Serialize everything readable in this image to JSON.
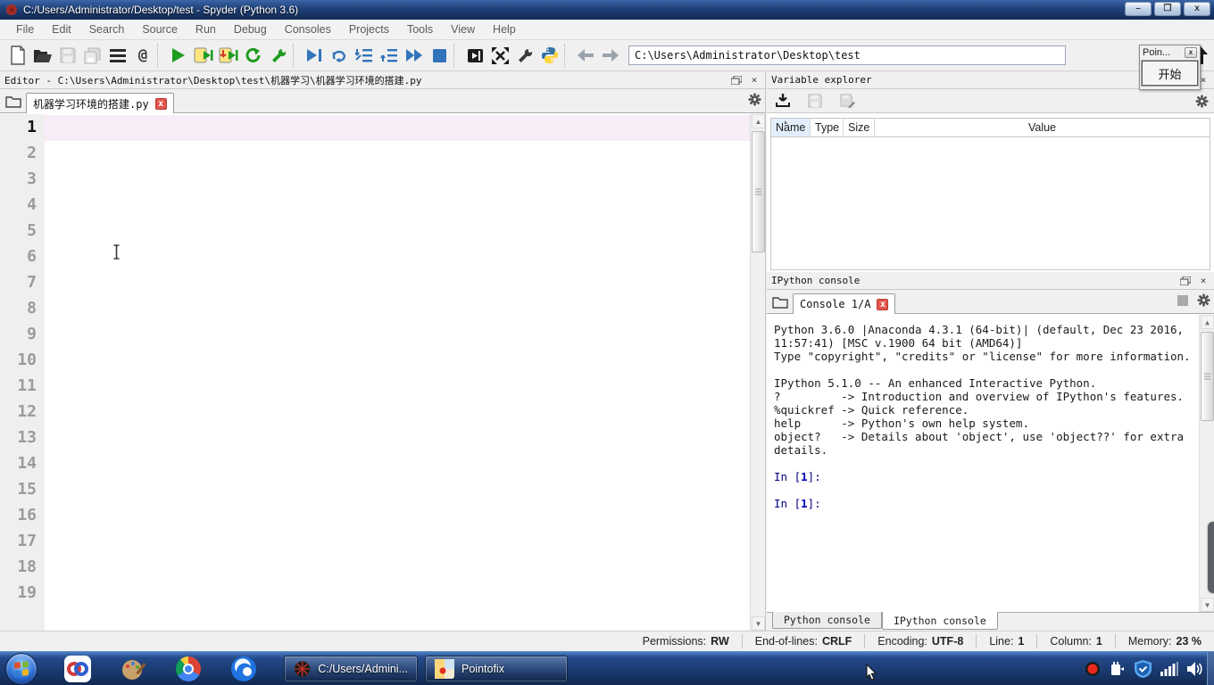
{
  "window": {
    "title": "C:/Users/Administrator/Desktop/test - Spyder (Python 3.6)",
    "buttons": {
      "minimize": "–",
      "restore": "❐",
      "close": "x"
    }
  },
  "menu": {
    "items": [
      "File",
      "Edit",
      "Search",
      "Source",
      "Run",
      "Debug",
      "Consoles",
      "Projects",
      "Tools",
      "View",
      "Help"
    ]
  },
  "toolbar": {
    "path_value": "C:\\Users\\Administrator\\Desktop\\test",
    "symbol_finder_label": "@"
  },
  "editor": {
    "header": "Editor - C:\\Users\\Administrator\\Desktop\\test\\机器学习\\机器学习环境的搭建.py",
    "tab": "机器学习环境的搭建.py",
    "tab_close": "x",
    "line_numbers": [
      "1",
      "2",
      "3",
      "4",
      "5",
      "6",
      "7",
      "8",
      "9",
      "10",
      "11",
      "12",
      "13",
      "14",
      "15",
      "16",
      "17",
      "18",
      "19"
    ]
  },
  "variable_explorer": {
    "header": "Variable explorer",
    "columns": {
      "name": "Name",
      "type": "Type",
      "size": "Size",
      "value": "Value"
    }
  },
  "console": {
    "header": "IPython console",
    "tab": "Console 1/A",
    "tab_close": "x",
    "banner": "Python 3.6.0 |Anaconda 4.3.1 (64-bit)| (default, Dec 23 2016,\n11:57:41) [MSC v.1900 64 bit (AMD64)]\nType \"copyright\", \"credits\" or \"license\" for more information.\n\nIPython 5.1.0 -- An enhanced Interactive Python.\n?         -> Introduction and overview of IPython's features.\n%quickref -> Quick reference.\nhelp      -> Python's own help system.\nobject?   -> Details about 'object', use 'object??' for extra\ndetails.",
    "prompt": {
      "prefix": "In [",
      "number": "1",
      "suffix": "]:"
    },
    "bottom_tabs": {
      "python": "Python console",
      "ipython": "IPython console"
    }
  },
  "statusbar": {
    "permissions_label": "Permissions:",
    "permissions_value": "RW",
    "eol_label": "End-of-lines:",
    "eol_value": "CRLF",
    "encoding_label": "Encoding:",
    "encoding_value": "UTF-8",
    "line_label": "Line:",
    "line_value": "1",
    "column_label": "Column:",
    "column_value": "1",
    "memory_label": "Memory:",
    "memory_value": "23 %"
  },
  "taskbar": {
    "spyder_window_label": "C:/Users/Admini...",
    "pointofix_window_label": "Pointofix"
  },
  "pointofix": {
    "title": "Poin...",
    "close": "x",
    "start_button": "开始"
  },
  "colors": {
    "run_green": "#1f9c1f",
    "debug_blue": "#3274ba",
    "tab_close_red": "#e2574c",
    "current_line_pink": "#f7edf7",
    "prompt_navy": "#000080",
    "titlebar_blue": "#1f4078",
    "taskbar_blue": "#1b3a6f"
  }
}
